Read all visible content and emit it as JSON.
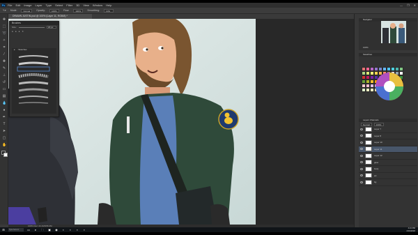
{
  "app": {
    "logo": "Ps",
    "menus": [
      "File",
      "Edit",
      "Image",
      "Layer",
      "Type",
      "Select",
      "Filter",
      "3D",
      "View",
      "Window",
      "Help"
    ],
    "window_controls": [
      "—",
      "❐",
      "✕"
    ]
  },
  "options_bar": {
    "items": [
      "Mode:",
      "Normal",
      "Opacity:",
      "100%",
      "Flow:",
      "100%",
      "Smoothing:",
      "10%"
    ]
  },
  "document": {
    "tab_title": "DRAWN JUSTIN.psd @ 100% (Layer 11, RGB/8) *",
    "zoom": "100%"
  },
  "brush_panel": {
    "title": "Brushes",
    "size_label": "Size:",
    "size_value": "20 px",
    "folder_label": "Sketches"
  },
  "right_panels": {
    "navigator_tab": "Navigator",
    "navigator_zoom": "100%",
    "swatches_tab": "Swatches",
    "layers_tabs": "Layers  Channels",
    "blend_mode": "Normal",
    "opacity": "100%"
  },
  "layers": [
    {
      "name": "Layer 7",
      "active": false
    },
    {
      "name": "Layer 8",
      "active": false
    },
    {
      "name": "Layer 10",
      "active": false
    },
    {
      "name": "Layer 11",
      "active": true
    },
    {
      "name": "Layer 12",
      "active": false
    },
    {
      "name": "glow",
      "active": false
    },
    {
      "name": "body",
      "active": false
    },
    {
      "name": "art",
      "active": false
    },
    {
      "name": "bg",
      "active": false
    }
  ],
  "statusbar": {
    "text": "100%    Doc: 24.1M/156.2M"
  },
  "taskbar": {
    "search_placeholder": "Type here to search",
    "time": "4:21 PM",
    "date": "2/19/2018"
  },
  "colors": {
    "jacket": "#2f4a3a",
    "shirt": "#5a7fb8",
    "canvas_bg": "#dce8e6",
    "layer_active": "#48566a"
  }
}
